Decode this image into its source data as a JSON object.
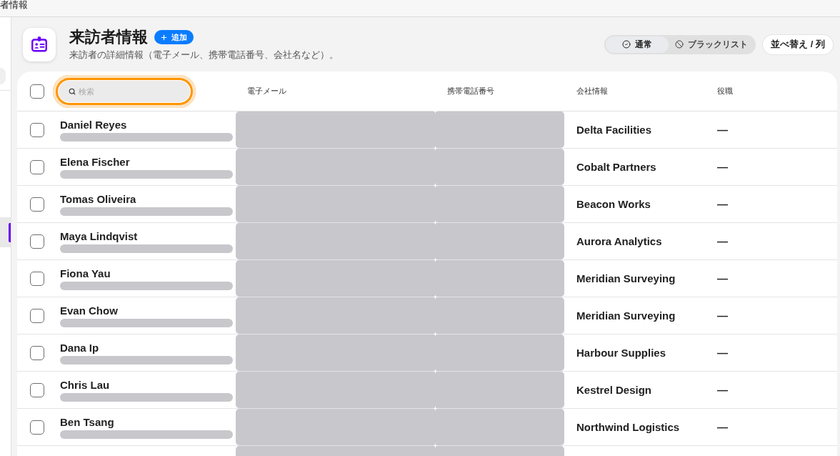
{
  "window": {
    "title": "者情報"
  },
  "sidebar": {
    "items": [
      {
        "selected": true
      }
    ]
  },
  "header": {
    "title": "来訪者情報",
    "add_button": "追加",
    "subtitle": "来訪者の詳細情報（電子メール、携帯電話番号、会社名など）。",
    "filters": [
      {
        "label": "通常",
        "selected": true
      },
      {
        "label": "ブラックリスト",
        "selected": false
      }
    ],
    "sort_button": "並べ替え / 列"
  },
  "table": {
    "select_all": {
      "checked": false
    },
    "search": {
      "placeholder": "検索",
      "focused": true
    },
    "columns": [
      "電子メール",
      "携帯電話番号",
      "会社情報",
      "役職"
    ],
    "rows": [
      {
        "name": "Daniel Reyes",
        "checked": false,
        "company": "Delta Facilities",
        "role": "—"
      },
      {
        "name": "Elena Fischer",
        "checked": false,
        "company": "Cobalt Partners",
        "role": "—"
      },
      {
        "name": "Tomas Oliveira",
        "checked": false,
        "company": "Beacon Works",
        "role": "—"
      },
      {
        "name": "Maya Lindqvist",
        "checked": false,
        "company": "Aurora Analytics",
        "role": "—"
      },
      {
        "name": "Fiona Yau",
        "checked": false,
        "company": "Meridian Surveying",
        "role": "—"
      },
      {
        "name": "Evan Chow",
        "checked": false,
        "company": "Meridian Surveying",
        "role": "—"
      },
      {
        "name": "Dana Ip",
        "checked": false,
        "company": "Harbour Supplies",
        "role": "—"
      },
      {
        "name": "Chris Lau",
        "checked": false,
        "company": "Kestrel Design",
        "role": "—"
      },
      {
        "name": "Ben Tsang",
        "checked": false,
        "company": "Northwind Logistics",
        "role": "—"
      }
    ]
  }
}
